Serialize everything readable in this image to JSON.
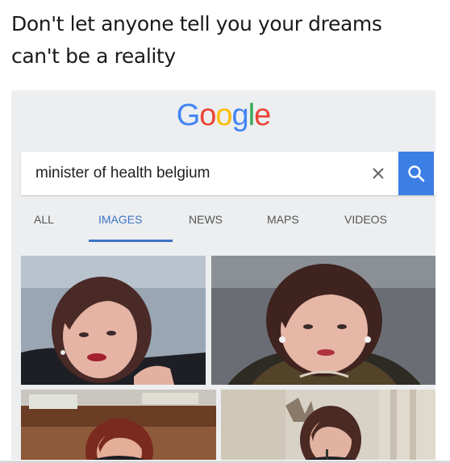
{
  "caption": {
    "line1": "Don't let anyone tell you your dreams",
    "line2": "can't be a reality"
  },
  "logo": {
    "letters": [
      {
        "char": "G",
        "color": "#4285f4"
      },
      {
        "char": "o",
        "color": "#ea4335"
      },
      {
        "char": "o",
        "color": "#fbbc05"
      },
      {
        "char": "g",
        "color": "#4285f4"
      },
      {
        "char": "l",
        "color": "#34a853"
      },
      {
        "char": "e",
        "color": "#ea4335"
      }
    ]
  },
  "search": {
    "query": "minister of health belgium",
    "clear_icon": "close-icon",
    "search_icon": "search-icon",
    "button_color": "#3b7fe4"
  },
  "tabs": [
    {
      "label": "ALL",
      "active": false
    },
    {
      "label": "IMAGES",
      "active": true
    },
    {
      "label": "NEWS",
      "active": false
    },
    {
      "label": "MAPS",
      "active": false
    },
    {
      "label": "VIDEOS",
      "active": false
    }
  ],
  "accent_color": "#3f74c4"
}
